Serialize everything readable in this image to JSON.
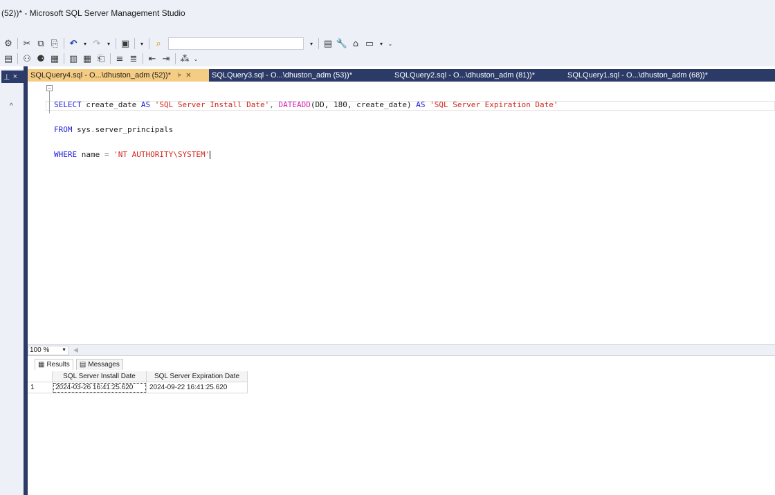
{
  "window": {
    "title": "(52))* - Microsoft SQL Server Management Studio"
  },
  "toolbar": {
    "row1_icons": [
      "new-query-icon",
      "cut-icon",
      "copy-icon",
      "paste-icon",
      "undo-icon",
      "redo-icon",
      "activity-monitor-icon",
      "find-icon",
      "solution-configurations-icon",
      "properties-icon",
      "toolbox-icon",
      "window-icon"
    ],
    "search_combo_value": "",
    "row2_icons": [
      "results-to-file-icon",
      "display-plan-icon",
      "include-plan-icon",
      "query-options-icon",
      "results-to-text-icon",
      "results-to-grid-icon",
      "results-file-icon",
      "comment-icon",
      "uncomment-icon",
      "decrease-indent-icon",
      "increase-indent-icon",
      "specify-values-icon"
    ]
  },
  "left_panel": {
    "pin_glyph": "&#x1F4CC;",
    "close_glyph": "×",
    "scroll_up": "^"
  },
  "tabs": [
    {
      "label": "SQLQuery4.sql - O...\\dhuston_adm (52))*",
      "active": true
    },
    {
      "label": "SQLQuery3.sql - O...\\dhuston_adm (53))*",
      "active": false
    },
    {
      "label": "SQLQuery2.sql - O...\\dhuston_adm (81))*",
      "active": false
    },
    {
      "label": "SQLQuery1.sql - O...\\dhuston_adm (68))*",
      "active": false
    }
  ],
  "editor": {
    "lines": [
      {
        "tokens": [
          {
            "t": "SELECT",
            "c": "kw"
          },
          {
            "t": " create_date ",
            "c": ""
          },
          {
            "t": "AS",
            "c": "kw"
          },
          {
            "t": " ",
            "c": ""
          },
          {
            "t": "'SQL Server Install Date'",
            "c": "str"
          },
          {
            "t": ", ",
            "c": "gray"
          },
          {
            "t": "DATEADD",
            "c": "fn"
          },
          {
            "t": "(DD, 180, create_date) ",
            "c": ""
          },
          {
            "t": "AS",
            "c": "kw"
          },
          {
            "t": " ",
            "c": ""
          },
          {
            "t": "'SQL Server Expiration Date'",
            "c": "str"
          }
        ]
      },
      {
        "tokens": [
          {
            "t": "FROM",
            "c": "kw"
          },
          {
            "t": " sys",
            "c": ""
          },
          {
            "t": ".",
            "c": "gray"
          },
          {
            "t": "server_principals",
            "c": ""
          }
        ]
      },
      {
        "tokens": [
          {
            "t": "WHERE",
            "c": "kw"
          },
          {
            "t": " name ",
            "c": ""
          },
          {
            "t": "=",
            "c": "gray"
          },
          {
            "t": " ",
            "c": ""
          },
          {
            "t": "'NT AUTHORITY\\SYSTEM'",
            "c": "str"
          }
        ]
      }
    ]
  },
  "zoom": {
    "value": "100 %"
  },
  "results": {
    "tabs": [
      {
        "label": "Results",
        "icon": "grid-icon"
      },
      {
        "label": "Messages",
        "icon": "messages-icon"
      }
    ],
    "columns": [
      "SQL Server Install Date",
      "SQL Server Expiration Date"
    ],
    "rows": [
      {
        "num": "1",
        "cells": [
          "2024-03-26 16:41:25.620",
          "2024-09-22 16:41:25.620"
        ]
      }
    ]
  },
  "colors": {
    "active_tab": "#f5cc84",
    "tab_bar": "#2b3a67",
    "keyword": "#1a1adb",
    "string": "#d1241a",
    "function": "#d61fb4"
  }
}
